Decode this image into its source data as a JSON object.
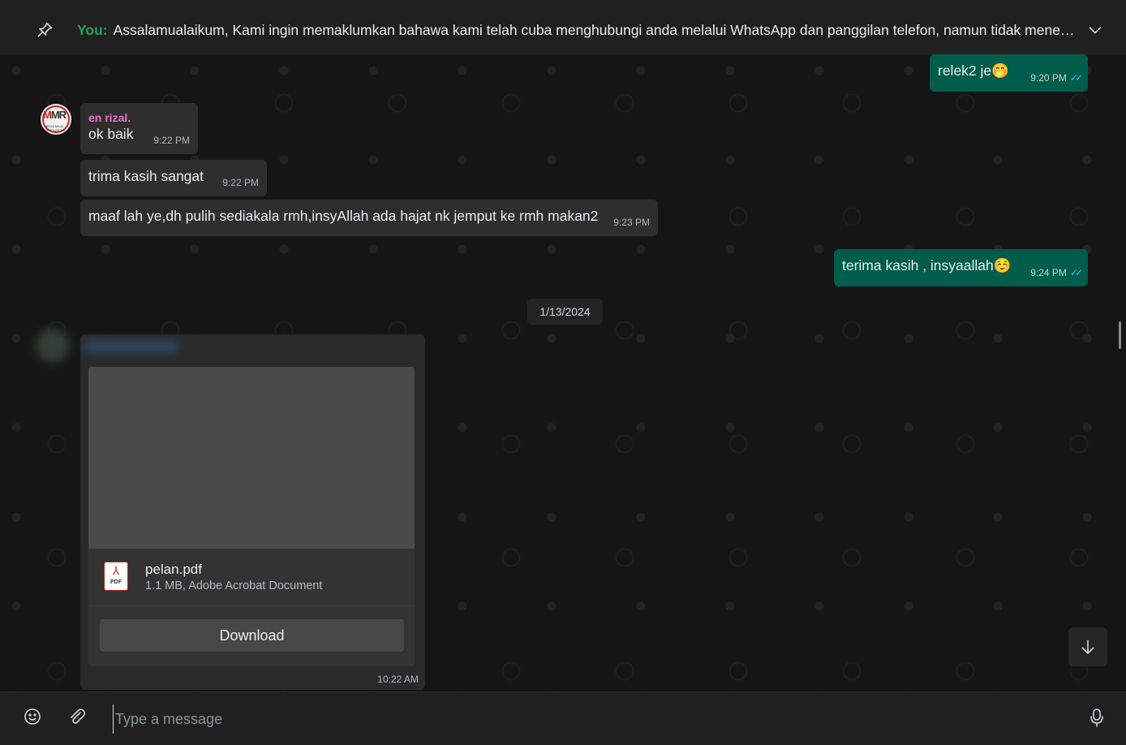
{
  "pinned": {
    "sender": "You:",
    "text": "Assalamualaikum,  Kami ingin memaklumkan bahawa kami telah cuba menghubungi anda melalui WhatsApp dan panggilan telefon, namun tidak mener…",
    "icons": {
      "pin": "pin-icon",
      "expand": "chevron-down-icon"
    }
  },
  "messages": [
    {
      "direction": "out",
      "text": "relek2 je🤭",
      "time": "9:20 PM",
      "status": "read"
    },
    {
      "direction": "in",
      "sender": "en rizal.",
      "text": "ok baik",
      "time": "9:22 PM"
    },
    {
      "direction": "in",
      "text": "trima kasih sangat",
      "time": "9:22 PM"
    },
    {
      "direction": "in",
      "text": "maaf lah ye,dh pulih sediakala rmh,insyAllah ada hajat nk jemput ke rmh makan2",
      "time": "9:23 PM"
    },
    {
      "direction": "out",
      "text": "terima kasih , insyaallah☺️",
      "time": "9:24 PM",
      "status": "read"
    }
  ],
  "avatar": {
    "mark": "MR",
    "mark_prefix": "M",
    "subtitle": "MEGA MAJU RESOURCES"
  },
  "date_separator": "1/13/2024",
  "document": {
    "file_name": "pelan.pdf",
    "file_meta": "1.1 MB, Adobe Acrobat Document",
    "file_type_label": "PDF",
    "download_label": "Download",
    "time": "10:22 AM"
  },
  "composer": {
    "placeholder": "Type a message",
    "icons": {
      "emoji": "emoji-icon",
      "attach": "paperclip-icon",
      "mic": "microphone-icon"
    }
  },
  "colors": {
    "incoming_bubble": "#2e2e2e",
    "outgoing_bubble": "#005c4b",
    "sender_name": "#e573c5",
    "you_label": "#25a25a",
    "read_tick": "#53bdeb"
  }
}
